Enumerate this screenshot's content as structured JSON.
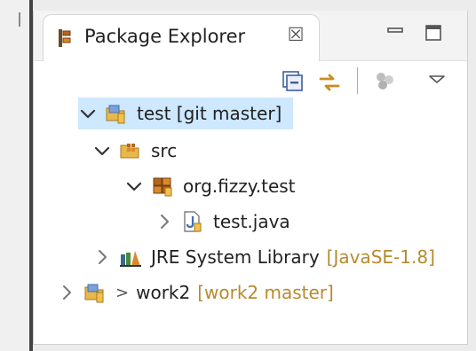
{
  "view": {
    "tab_title": "Package Explorer",
    "close_glyph": "☒"
  },
  "icons": {
    "tab": "package-explorer-icon",
    "minimize": "minimize-icon",
    "maximize": "maximize-icon",
    "collapse_all": "collapse-all-icon",
    "link_with_editor": "link-with-editor-icon",
    "filters": "filters-icon",
    "view_menu": "view-menu-icon"
  },
  "tree": {
    "test_project": {
      "label": "test [git master]"
    },
    "src_folder": {
      "label": "src"
    },
    "package": {
      "label": "org.fizzy.test"
    },
    "java_file": {
      "label": "test.java"
    },
    "jre_library": {
      "label": "JRE System Library",
      "suffix": "[JavaSE-1.8]"
    },
    "work2_project": {
      "prefix": ">",
      "label": "work2",
      "suffix": "[work2 master]"
    }
  },
  "colors": {
    "selection": "#cde8ff",
    "git_annotation": "#b88a2e",
    "folder_yellow": "#e8b84a",
    "package_brown": "#b5651d",
    "java_blue": "#3f6fb5"
  }
}
